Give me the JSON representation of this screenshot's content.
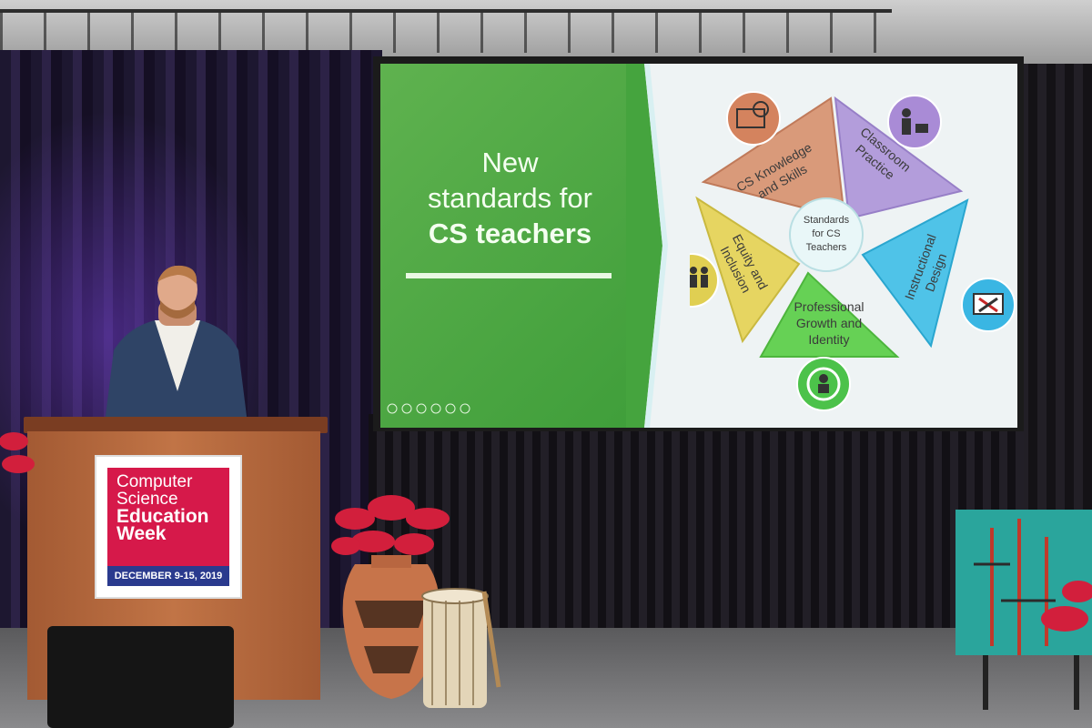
{
  "slide": {
    "title_line1": "New",
    "title_line2": "standards for",
    "title_line3": "CS teachers",
    "center_line1": "Standards",
    "center_line2": "for CS",
    "center_line3": "Teachers",
    "segments": [
      {
        "line1": "CS Knowledge",
        "line2": "and Skills",
        "color": "#d99a7a",
        "icon": "computer-gear-icon"
      },
      {
        "line1": "Classroom",
        "line2": "Practice",
        "color": "#b39ddb",
        "icon": "teacher-student-icon"
      },
      {
        "line1": "Instructional",
        "line2": "Design",
        "color": "#4fc3e8",
        "icon": "monitor-design-icon"
      },
      {
        "line1": "Professional",
        "line2": "Growth and",
        "line3": "Identity",
        "color": "#66d155",
        "icon": "person-cycle-icon"
      },
      {
        "line1": "Equity and",
        "line2": "Inclusion",
        "color": "#e6d561",
        "icon": "people-blocks-icon"
      }
    ]
  },
  "podium_sign": {
    "line1": "Computer",
    "line2": "Science",
    "line3": "Education",
    "line4": "Week",
    "date": "DECEMBER 9-15, 2019"
  },
  "colors": {
    "slide_green": "#4caf50",
    "sign_red": "#d6194a",
    "sign_blue": "#2a3a8e"
  }
}
